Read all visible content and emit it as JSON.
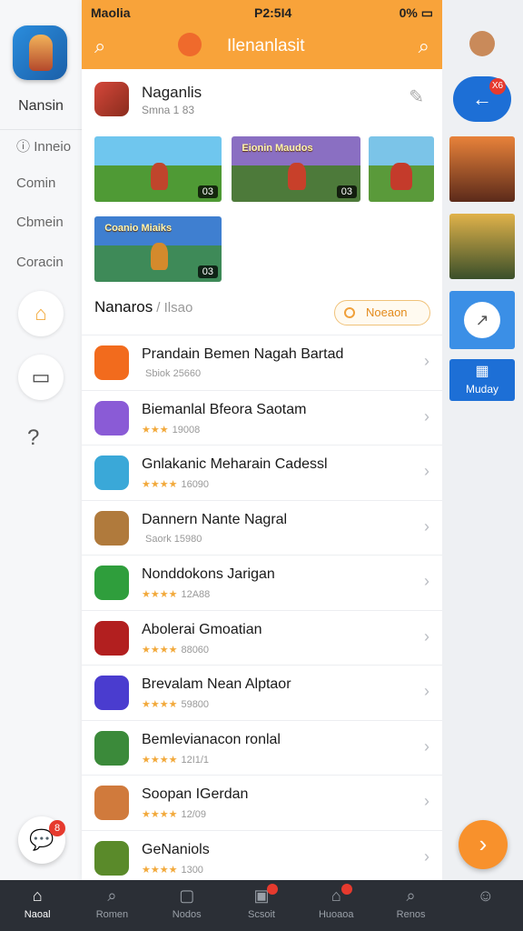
{
  "status": {
    "carrier": "Maolia",
    "time": "P2:5I4",
    "battery": "0%"
  },
  "header": {
    "title": "Ilenanlasit"
  },
  "left_rail": {
    "title": "Nansin",
    "links": [
      "Inneio",
      "Comin",
      "Cbmein",
      "Coracin"
    ],
    "chat_badge": "8"
  },
  "featured": {
    "name": "Naganlis",
    "meta": "Smna 1 83"
  },
  "thumbnails": [
    {
      "count": "03",
      "banner": ""
    },
    {
      "count": "03",
      "banner": "Eionin Maudos"
    },
    {
      "count": "",
      "banner": ""
    },
    {
      "count": "03",
      "banner": "Coanio Miaiks"
    }
  ],
  "section": {
    "title": "Nanaros",
    "subtitle": "/ Ilsao",
    "pill": "Noeaon"
  },
  "list": [
    {
      "name": "Prandain Bemen Nagah Bartad",
      "meta": "Sbiok 25660",
      "stars": "",
      "color": "#f26b1d"
    },
    {
      "name": "Biemanlal Bfeora Saotam",
      "meta": "19008",
      "stars": "★★★",
      "color": "#8a5bd6"
    },
    {
      "name": "Gnlakanic Meharain Cadessl",
      "meta": "16090",
      "stars": "★★★★",
      "color": "#3aa8d8"
    },
    {
      "name": "Dannern Nante Nagral",
      "meta": "Saork 15980",
      "stars": "",
      "color": "#b07a3c"
    },
    {
      "name": "Nonddokons Jarigan",
      "meta": "12A88",
      "stars": "★★★★",
      "color": "#2f9e3c"
    },
    {
      "name": "Abolerai Gmoatian",
      "meta": "88060",
      "stars": "★★★★",
      "color": "#b21f1f"
    },
    {
      "name": "Brevalam Nean Alptaor",
      "meta": "59800",
      "stars": "★★★★",
      "color": "#4a3ccf"
    },
    {
      "name": "Bemlevianacon ronlal",
      "meta": "12I1/1",
      "stars": "★★★★",
      "color": "#3b8a3a"
    },
    {
      "name": "Soopan IGerdan",
      "meta": "12/09",
      "stars": "★★★★",
      "color": "#d07a3c"
    },
    {
      "name": "GeNaniols",
      "meta": "1300",
      "stars": "★★★★",
      "color": "#5a8a2a"
    }
  ],
  "right_rail": {
    "back_badge": "X6",
    "monday": "Muday"
  },
  "tabs": [
    {
      "label": "Naoal",
      "icon": "home-icon",
      "glyph": "⌂",
      "active": true
    },
    {
      "label": "Romen",
      "icon": "search-icon",
      "glyph": "⌕",
      "active": false
    },
    {
      "label": "Nodos",
      "icon": "chat-icon",
      "glyph": "▢",
      "active": false
    },
    {
      "label": "Scsoit",
      "icon": "game-icon",
      "glyph": "▣",
      "active": false,
      "badge": true
    },
    {
      "label": "Huoaoa",
      "icon": "store-icon",
      "glyph": "⌂",
      "active": false,
      "badge": true
    },
    {
      "label": "Renos",
      "icon": "search-icon",
      "glyph": "⌕",
      "active": false
    },
    {
      "label": "",
      "icon": "profile-icon",
      "glyph": "☺",
      "active": false
    }
  ],
  "colors": {
    "accent": "#f8a33a",
    "brand_blue": "#1d6fd6",
    "tabbar": "#2b2f36"
  }
}
